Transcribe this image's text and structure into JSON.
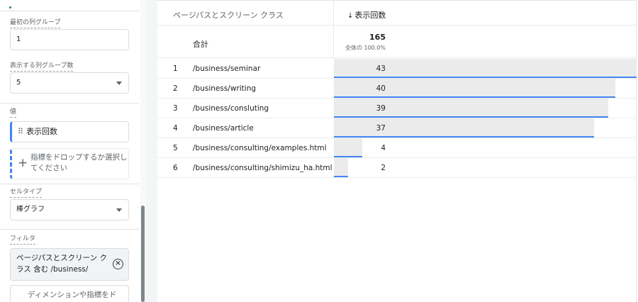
{
  "left_panel": {
    "first_col_group_label": "最初の列グループ",
    "first_col_group_value": "1",
    "show_col_groups_label": "表示する列グループ数",
    "show_col_groups_value": "5",
    "value_section_label": "値",
    "metric_chip": "表示回数",
    "drop_zone_text": "指標をドロップするか選択してください",
    "cell_type_label": "セルタイプ",
    "cell_type_value": "棒グラフ",
    "filter_label": "フィルタ",
    "filter_chip_text": "ページパスとスクリーン クラス 含む /business/",
    "add_filter_text": "ディメンションや指標をド"
  },
  "table": {
    "dimension_header": "ページパスとスクリーン クラス",
    "metric_header": "表示回数",
    "total_label": "合計",
    "total_value": "165",
    "total_pct": "全体の 100.0%",
    "accent_color": "#4285f4",
    "rows": [
      {
        "num": "1",
        "page": "/business/seminar",
        "value": "43"
      },
      {
        "num": "2",
        "page": "/business/writing",
        "value": "40"
      },
      {
        "num": "3",
        "page": "/business/consluting",
        "value": "39"
      },
      {
        "num": "4",
        "page": "/business/article",
        "value": "37"
      },
      {
        "num": "5",
        "page": "/business/consulting/examples.html",
        "value": "4"
      },
      {
        "num": "6",
        "page": "/business/consulting/shimizu_ha.html",
        "value": "2"
      }
    ]
  }
}
